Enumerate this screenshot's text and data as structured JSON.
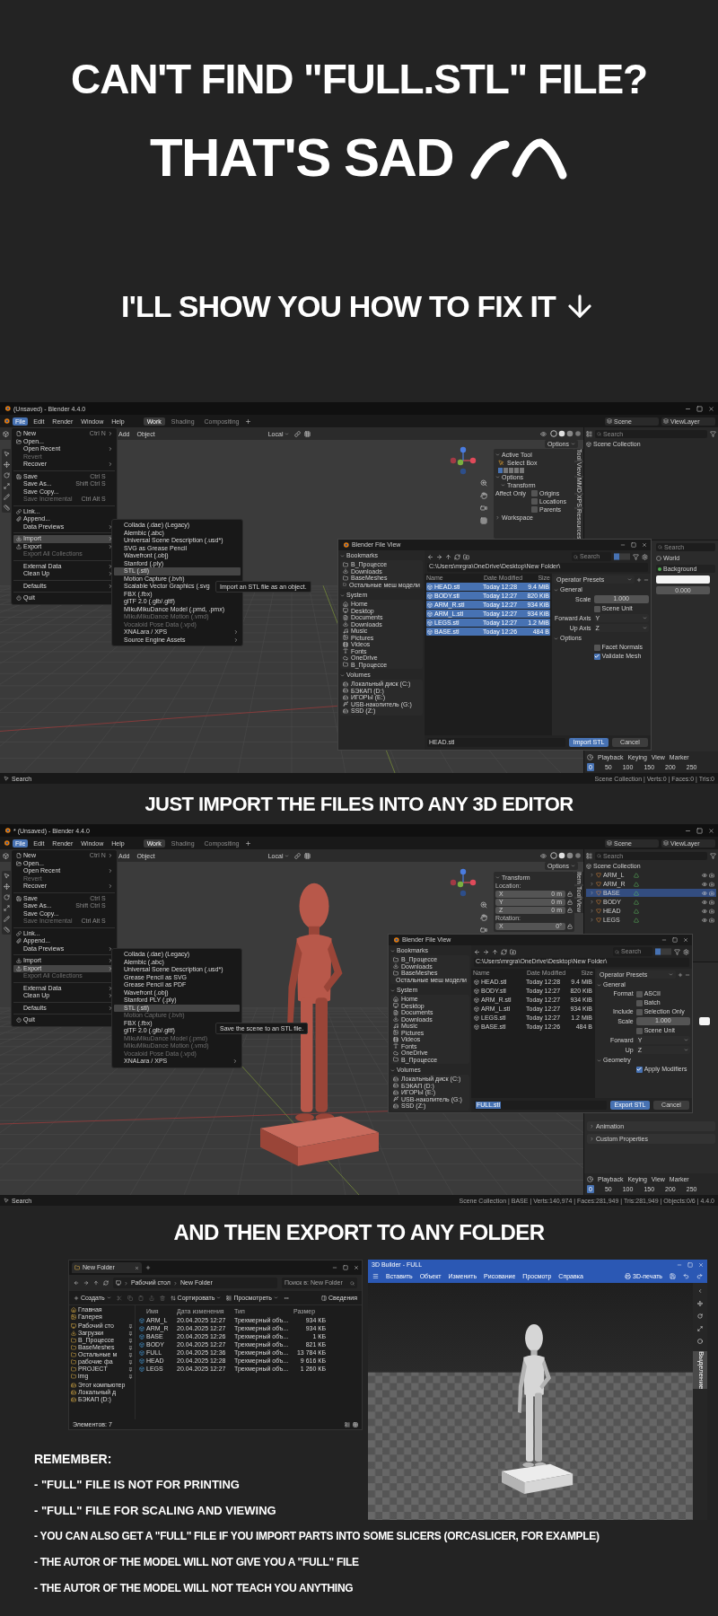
{
  "headline": {
    "line_1": "CAN'T FIND \"FULL.STL\" FILE?",
    "line_2": "THAT'S SAD",
    "line_3": "I'LL SHOW YOU HOW TO FIX IT"
  },
  "import_screenshot": {
    "title": "(Unsaved) - Blender 4.4.0",
    "menus": [
      {
        "label": "File",
        "selected": true
      },
      {
        "label": "Edit",
        "selected": false
      },
      {
        "label": "Render",
        "selected": false
      },
      {
        "label": "Window",
        "selected": false
      },
      {
        "label": "Help",
        "selected": false
      }
    ],
    "workspaces": [
      {
        "label": "Work",
        "selected": true
      },
      {
        "label": "Shading",
        "selected": false
      },
      {
        "label": "Compositing",
        "selected": false
      }
    ],
    "scene": "Scene",
    "view_layer": "ViewLayer",
    "viewport_menus": [
      "Add",
      "Object"
    ],
    "orientation": "Local",
    "options_button": "Options",
    "file_menu": [
      {
        "kind": "item",
        "label": "New",
        "shortcut": "Ctrl N",
        "submenu": true,
        "disabled": false,
        "selected": false
      },
      {
        "kind": "item",
        "label": "Open...",
        "submenu": false,
        "disabled": false,
        "selected": false
      },
      {
        "kind": "item",
        "label": "Open Recent",
        "submenu": true,
        "disabled": false,
        "selected": false
      },
      {
        "kind": "item",
        "label": "Revert",
        "submenu": false,
        "disabled": true,
        "selected": false
      },
      {
        "kind": "item",
        "label": "Recover",
        "submenu": true,
        "disabled": false,
        "selected": false
      },
      {
        "kind": "separator"
      },
      {
        "kind": "item",
        "label": "Save",
        "shortcut": "Ctrl S",
        "submenu": false,
        "disabled": false,
        "selected": false
      },
      {
        "kind": "item",
        "label": "Save As...",
        "shortcut": "Shift Ctrl S",
        "submenu": false,
        "disabled": false,
        "selected": false
      },
      {
        "kind": "item",
        "label": "Save Copy...",
        "submenu": false,
        "disabled": false,
        "selected": false
      },
      {
        "kind": "item",
        "label": "Save Incremental",
        "shortcut": "Ctrl Alt S",
        "submenu": false,
        "disabled": true,
        "selected": false
      },
      {
        "kind": "separator"
      },
      {
        "kind": "item",
        "label": "Link...",
        "submenu": false,
        "disabled": false,
        "selected": false
      },
      {
        "kind": "item",
        "label": "Append...",
        "submenu": false,
        "disabled": false,
        "selected": false
      },
      {
        "kind": "item",
        "label": "Data Previews",
        "submenu": true,
        "disabled": false,
        "selected": false
      },
      {
        "kind": "separator"
      },
      {
        "kind": "item",
        "label": "Import",
        "submenu": true,
        "disabled": false,
        "selected": true
      },
      {
        "kind": "item",
        "label": "Export",
        "submenu": true,
        "disabled": false,
        "selected": false
      },
      {
        "kind": "item",
        "label": "Export All Collections",
        "submenu": false,
        "disabled": true,
        "selected": false
      },
      {
        "kind": "separator"
      },
      {
        "kind": "item",
        "label": "External Data",
        "submenu": true,
        "disabled": false,
        "selected": false
      },
      {
        "kind": "item",
        "label": "Clean Up",
        "submenu": true,
        "disabled": false,
        "selected": false
      },
      {
        "kind": "separator"
      },
      {
        "kind": "item",
        "label": "Defaults",
        "submenu": true,
        "disabled": false,
        "selected": false
      },
      {
        "kind": "separator"
      },
      {
        "kind": "item",
        "label": "Quit",
        "submenu": false,
        "disabled": false,
        "selected": false
      }
    ],
    "submenu": [
      {
        "kind": "item",
        "label": "Collada (.dae) (Legacy)",
        "submenu": false,
        "disabled": false,
        "selected": false
      },
      {
        "kind": "item",
        "label": "Alembic (.abc)",
        "submenu": false,
        "disabled": false,
        "selected": false
      },
      {
        "kind": "item",
        "label": "Universal Scene Description (.usd*)",
        "submenu": false,
        "disabled": false,
        "selected": false
      },
      {
        "kind": "item",
        "label": "SVG as Grease Pencil",
        "submenu": false,
        "disabled": false,
        "selected": false
      },
      {
        "kind": "item",
        "label": "Wavefront (.obj)",
        "submenu": false,
        "disabled": false,
        "selected": false
      },
      {
        "kind": "item",
        "label": "Stanford (.ply)",
        "submenu": false,
        "disabled": false,
        "selected": false
      },
      {
        "kind": "item",
        "label": "STL (.stl)",
        "submenu": false,
        "disabled": false,
        "selected": true
      },
      {
        "kind": "item",
        "label": "Motion Capture (.bvh)",
        "submenu": false,
        "disabled": false,
        "selected": false
      },
      {
        "kind": "item",
        "label": "Scalable Vector Graphics (.svg",
        "disabled": false,
        "selected": false
      },
      {
        "kind": "item",
        "label": "FBX (.fbx)",
        "submenu": false,
        "disabled": false,
        "selected": false
      },
      {
        "kind": "item",
        "label": "glTF 2.0 (.glb/.gltf)",
        "submenu": false,
        "disabled": false,
        "selected": false
      },
      {
        "kind": "item",
        "label": "MikuMikuDance Model (.pmd, .pmx)",
        "submenu": false,
        "disabled": false,
        "selected": false
      },
      {
        "kind": "item",
        "label": "MikuMikuDance Motion (.vmd)",
        "submenu": false,
        "disabled": true,
        "selected": false
      },
      {
        "kind": "item",
        "label": "Vocaloid Pose Data (.vpd)",
        "submenu": false,
        "disabled": true,
        "selected": false
      },
      {
        "kind": "item",
        "label": "XNALara / XPS",
        "submenu": true,
        "disabled": false,
        "selected": false
      },
      {
        "kind": "item",
        "label": "Source Engine Assets",
        "submenu": true,
        "disabled": false,
        "selected": false
      }
    ],
    "tooltip": "Import an STL file as an object.",
    "side_panel": [
      {
        "kind": "header",
        "label": "Active Tool"
      },
      {
        "kind": "tool",
        "label": "Select Box"
      },
      {
        "kind": "header",
        "label": "Options"
      },
      {
        "kind": "subheader",
        "label": "Transform"
      },
      {
        "kind": "check",
        "prefix": "Affect Only",
        "label": "Origins",
        "checked": false
      },
      {
        "kind": "check",
        "label": "Locations",
        "checked": false
      },
      {
        "kind": "check",
        "label": "Parents",
        "checked": false
      },
      {
        "kind": "collapsed",
        "label": "Workspace"
      }
    ],
    "side_tabs": [
      "Tool",
      "View",
      "MMD",
      "XPS",
      "Resources"
    ],
    "outliner": {
      "search_placeholder": "Search",
      "collection": "Scene Collection"
    },
    "properties": {
      "search_placeholder": "Search",
      "rows": [
        {
          "kind": "title",
          "label": "World"
        },
        {
          "kind": "shader",
          "label": "Background"
        },
        {
          "kind": "color"
        },
        {
          "kind": "number",
          "value": "0.000"
        }
      ]
    },
    "file_dialog": {
      "title": "Blender File View",
      "bookmarks_label": "Bookmarks",
      "bookmarks": [
        "В_Процессе",
        "Downloads",
        "BaseMeshes",
        "Остальные меш модели"
      ],
      "system_label": "System",
      "system": [
        "Home",
        "Desktop",
        "Documents",
        "Downloads",
        "Music",
        "Pictures",
        "Videos",
        "Fonts",
        "OneDrive",
        "В_Процессе"
      ],
      "volumes_label": "Volumes",
      "volumes": [
        "Локальный диск (C:)",
        "БЭКАП (D:)",
        "ИГОРЫ (E:)",
        "USB-накопитель (G:)",
        "SSD (Z:)"
      ],
      "path": "C:\\Users\\mrgra\\OneDrive\\Desktop\\New Folder\\",
      "search_placeholder": "Search",
      "columns": [
        "Name",
        "Date Modified",
        "Size"
      ],
      "files": [
        {
          "name": "HEAD.stl",
          "date": "Today 12:28",
          "size": "9.4 MiB",
          "selected": true
        },
        {
          "name": "BODY.stl",
          "date": "Today 12:27",
          "size": "820 KiB",
          "selected": true
        },
        {
          "name": "ARM_R.stl",
          "date": "Today 12:27",
          "size": "934 KiB",
          "selected": true
        },
        {
          "name": "ARM_L.stl",
          "date": "Today 12:27",
          "size": "934 KiB",
          "selected": true
        },
        {
          "name": "LEGS.stl",
          "date": "Today 12:27",
          "size": "1.2 MiB",
          "selected": true
        },
        {
          "name": "BASE.stl",
          "date": "Today 12:26",
          "size": "484 B",
          "selected": true
        }
      ],
      "options": [
        {
          "kind": "presets",
          "label": "Operator Presets"
        },
        {
          "kind": "section",
          "label": "General"
        },
        {
          "kind": "number",
          "label": "Scale",
          "value": "1.000"
        },
        {
          "kind": "check",
          "label": "Scene Unit",
          "checked": false
        },
        {
          "kind": "select",
          "label": "Forward Axis",
          "value": "Y"
        },
        {
          "kind": "select",
          "label": "Up Axis",
          "value": "Z"
        },
        {
          "kind": "section",
          "label": "Options"
        },
        {
          "kind": "check",
          "label": "Facet Normals",
          "checked": false
        },
        {
          "kind": "check",
          "label": "Validate Mesh",
          "checked": true
        }
      ],
      "filename": "HEAD.stl",
      "filename_highlighted": false,
      "primary_button": "Import STL",
      "cancel_button": "Cancel"
    },
    "timeline": {
      "menus": [
        "Playback",
        "Keying",
        "View",
        "Marker"
      ],
      "current_frame": "0",
      "ticks": [
        "50",
        "100",
        "150",
        "200",
        "250"
      ]
    },
    "status": {
      "left": "Search",
      "right": "Scene Collection | Verts:0 | Faces:0 | Tris:0"
    }
  },
  "import_caption": "JUST IMPORT THE FILES INTO ANY 3D EDITOR",
  "export_screenshot": {
    "title": "* (Unsaved) - Blender 4.4.0",
    "menus": [
      {
        "label": "File",
        "selected": true
      },
      {
        "label": "Edit",
        "selected": false
      },
      {
        "label": "Render",
        "selected": false
      },
      {
        "label": "Window",
        "selected": false
      },
      {
        "label": "Help",
        "selected": false
      }
    ],
    "workspaces": [
      {
        "label": "Work",
        "selected": true
      },
      {
        "label": "Shading",
        "selected": false
      },
      {
        "label": "Compositing",
        "selected": false
      }
    ],
    "scene": "Scene",
    "view_layer": "ViewLayer",
    "viewport_menus": [
      "Add",
      "Object"
    ],
    "orientation": "Local",
    "options_button": "Options",
    "file_menu": [
      {
        "kind": "item",
        "label": "New",
        "shortcut": "Ctrl N",
        "submenu": true,
        "disabled": false,
        "selected": false
      },
      {
        "kind": "item",
        "label": "Open...",
        "submenu": false,
        "disabled": false,
        "selected": false
      },
      {
        "kind": "item",
        "label": "Open Recent",
        "submenu": true,
        "disabled": false,
        "selected": false
      },
      {
        "kind": "item",
        "label": "Revert",
        "submenu": false,
        "disabled": true,
        "selected": false
      },
      {
        "kind": "item",
        "label": "Recover",
        "submenu": true,
        "disabled": false,
        "selected": false
      },
      {
        "kind": "separator"
      },
      {
        "kind": "item",
        "label": "Save",
        "shortcut": "Ctrl S",
        "submenu": false,
        "disabled": false,
        "selected": false
      },
      {
        "kind": "item",
        "label": "Save As...",
        "shortcut": "Shift Ctrl S",
        "submenu": false,
        "disabled": false,
        "selected": false
      },
      {
        "kind": "item",
        "label": "Save Copy...",
        "submenu": false,
        "disabled": false,
        "selected": false
      },
      {
        "kind": "item",
        "label": "Save Incremental",
        "shortcut": "Ctrl Alt S",
        "submenu": false,
        "disabled": true,
        "selected": false
      },
      {
        "kind": "separator"
      },
      {
        "kind": "item",
        "label": "Link...",
        "submenu": false,
        "disabled": false,
        "selected": false
      },
      {
        "kind": "item",
        "label": "Append...",
        "submenu": false,
        "disabled": false,
        "selected": false
      },
      {
        "kind": "item",
        "label": "Data Previews",
        "submenu": true,
        "disabled": false,
        "selected": false
      },
      {
        "kind": "separator"
      },
      {
        "kind": "item",
        "label": "Import",
        "submenu": true,
        "disabled": false,
        "selected": false
      },
      {
        "kind": "item",
        "label": "Export",
        "submenu": true,
        "disabled": false,
        "selected": true
      },
      {
        "kind": "item",
        "label": "Export All Collections",
        "submenu": false,
        "disabled": true,
        "selected": false
      },
      {
        "kind": "separator"
      },
      {
        "kind": "item",
        "label": "External Data",
        "submenu": true,
        "disabled": false,
        "selected": false
      },
      {
        "kind": "item",
        "label": "Clean Up",
        "submenu": true,
        "disabled": false,
        "selected": false
      },
      {
        "kind": "separator"
      },
      {
        "kind": "item",
        "label": "Defaults",
        "submenu": true,
        "disabled": false,
        "selected": false
      },
      {
        "kind": "separator"
      },
      {
        "kind": "item",
        "label": "Quit",
        "submenu": false,
        "disabled": false,
        "selected": false
      }
    ],
    "submenu": [
      {
        "kind": "item",
        "label": "Collada (.dae) (Legacy)",
        "submenu": false,
        "disabled": false,
        "selected": false
      },
      {
        "kind": "item",
        "label": "Alembic (.abc)",
        "submenu": false,
        "disabled": false,
        "selected": false
      },
      {
        "kind": "item",
        "label": "Universal Scene Description (.usd*)",
        "submenu": false,
        "disabled": false,
        "selected": false
      },
      {
        "kind": "item",
        "label": "Grease Pencil as SVG",
        "submenu": false,
        "disabled": false,
        "selected": false
      },
      {
        "kind": "item",
        "label": "Grease Pencil as PDF",
        "submenu": false,
        "disabled": false,
        "selected": false
      },
      {
        "kind": "item",
        "label": "Wavefront (.obj)",
        "submenu": false,
        "disabled": false,
        "selected": false
      },
      {
        "kind": "item",
        "label": "Stanford PLY (.ply)",
        "submenu": false,
        "disabled": false,
        "selected": false
      },
      {
        "kind": "item",
        "label": "STL (.stl)",
        "submenu": false,
        "disabled": false,
        "selected": true
      },
      {
        "kind": "item",
        "label": "Motion Capture (.bvh)",
        "submenu": false,
        "disabled": true,
        "selected": false
      },
      {
        "kind": "item",
        "label": "FBX (.fbx)",
        "disabled": false,
        "selected": false
      },
      {
        "kind": "item",
        "label": "glTF 2.0 (.glb/.gltf)",
        "disabled": false,
        "selected": false
      },
      {
        "kind": "item",
        "label": "MikuMikuDance Model (.pmd)",
        "submenu": false,
        "disabled": true,
        "selected": false
      },
      {
        "kind": "item",
        "label": "MikuMikuDance Motion (.vmd)",
        "submenu": false,
        "disabled": true,
        "selected": false
      },
      {
        "kind": "item",
        "label": "Vocaloid Pose Data (.vpd)",
        "submenu": false,
        "disabled": true,
        "selected": false
      },
      {
        "kind": "item",
        "label": "XNALara / XPS",
        "submenu": true,
        "disabled": false,
        "selected": false
      }
    ],
    "tooltip": "Save the scene to an STL file.",
    "side_panel": [
      {
        "kind": "header",
        "label": "Transform"
      },
      {
        "kind": "label",
        "label": "Location:"
      },
      {
        "kind": "field",
        "axis": "X",
        "value": "0 m"
      },
      {
        "kind": "field",
        "axis": "Y",
        "value": "0 m"
      },
      {
        "kind": "field",
        "axis": "Z",
        "value": "0 m"
      },
      {
        "kind": "label",
        "label": "Rotation:"
      },
      {
        "kind": "field",
        "axis": "X",
        "value": "0°"
      }
    ],
    "side_tabs": [
      "Item",
      "Tool",
      "View"
    ],
    "outliner": {
      "search_placeholder": "Search",
      "collection": "Scene Collection",
      "objects": [
        {
          "name": "ARM_L",
          "selected": false
        },
        {
          "name": "ARM_R",
          "selected": false
        },
        {
          "name": "BASE",
          "selected": true
        },
        {
          "name": "BODY",
          "selected": false
        },
        {
          "name": "HEAD",
          "selected": false
        },
        {
          "name": "LEGS",
          "selected": false
        }
      ]
    },
    "properties": {
      "rows": [
        {
          "kind": "color"
        },
        {
          "kind": "section",
          "label": "Animation"
        },
        {
          "kind": "section",
          "label": "Custom Properties"
        }
      ]
    },
    "file_dialog": {
      "title": "Blender File View",
      "bookmarks_label": "Bookmarks",
      "bookmarks": [
        "В_Процессе",
        "Downloads",
        "BaseMeshes",
        "Остальные меш модели"
      ],
      "system_label": "System",
      "system": [
        "Home",
        "Desktop",
        "Documents",
        "Downloads",
        "Music",
        "Pictures",
        "Videos",
        "Fonts",
        "OneDrive",
        "В_Процессе"
      ],
      "volumes_label": "Volumes",
      "volumes": [
        "Локальный диск (C:)",
        "БЭКАП (D:)",
        "ИГОРЫ (E:)",
        "USB-накопитель (G:)",
        "SSD (Z:)"
      ],
      "path": "C:\\Users\\mrgra\\OneDrive\\Desktop\\New Folder\\",
      "search_placeholder": "Search",
      "columns": [
        "Name",
        "Date Modified",
        "Size"
      ],
      "files": [
        {
          "name": "HEAD.stl",
          "date": "Today 12:28",
          "size": "9.4 MiB",
          "selected": false
        },
        {
          "name": "BODY.stl",
          "date": "Today 12:27",
          "size": "820 KiB",
          "selected": false
        },
        {
          "name": "ARM_R.stl",
          "date": "Today 12:27",
          "size": "934 KiB",
          "selected": false
        },
        {
          "name": "ARM_L.stl",
          "date": "Today 12:27",
          "size": "934 KiB",
          "selected": false
        },
        {
          "name": "LEGS.stl",
          "date": "Today 12:27",
          "size": "1.2 MiB",
          "selected": false
        },
        {
          "name": "BASE.stl",
          "date": "Today 12:26",
          "size": "484 B",
          "selected": false
        }
      ],
      "options": [
        {
          "kind": "presets",
          "label": "Operator Presets"
        },
        {
          "kind": "section",
          "label": "General"
        },
        {
          "kind": "check",
          "prefix": "Format",
          "label": "ASCII",
          "checked": false
        },
        {
          "kind": "check",
          "label": "Batch",
          "checked": false
        },
        {
          "kind": "check",
          "prefix": "Include",
          "label": "Selection Only",
          "checked": false
        },
        {
          "kind": "number",
          "label": "Scale",
          "value": "1.000"
        },
        {
          "kind": "check",
          "label": "Scene Unit",
          "checked": false
        },
        {
          "kind": "select",
          "label": "Forward",
          "value": "Y"
        },
        {
          "kind": "select",
          "label": "Up",
          "value": "Z"
        },
        {
          "kind": "section",
          "label": "Geometry"
        },
        {
          "kind": "check",
          "label": "Apply Modifiers",
          "checked": true
        }
      ],
      "filename": "FULL.stl",
      "filename_highlighted": true,
      "primary_button": "Export STL",
      "cancel_button": "Cancel"
    },
    "timeline": {
      "menus": [
        "Playback",
        "Keying",
        "View",
        "Marker"
      ],
      "current_frame": "0",
      "ticks": [
        "50",
        "100",
        "150",
        "200",
        "250"
      ]
    },
    "status": {
      "left": "Search",
      "right": "Scene Collection | BASE | Verts:140,974 | Faces:281,949 | Tris:281,949 | Objects:0/6 | 4.4.0"
    }
  },
  "export_caption": "AND THEN EXPORT TO ANY FOLDER",
  "file_explorer": {
    "tab": "New Folder",
    "breadcrumbs": [
      "Рабочий стол",
      "New Folder"
    ],
    "search_placeholder": "Поиск в: New Folder",
    "commands": [
      "Создать",
      "Сортировать",
      "Просмотреть"
    ],
    "details_button": "Сведения",
    "nav": [
      {
        "label": "Главная",
        "pinned": false
      },
      {
        "label": "Галерея",
        "pinned": false
      },
      {
        "label": "Рабочий сто",
        "pinned": true
      },
      {
        "label": "Загрузки",
        "pinned": true
      },
      {
        "label": "В_Процессе",
        "pinned": true
      },
      {
        "label": "BaseMeshes",
        "pinned": true
      },
      {
        "label": "Остальные м",
        "pinned": true
      },
      {
        "label": "рабочие фа",
        "pinned": true
      },
      {
        "label": "PROJECT",
        "pinned": true
      },
      {
        "label": "img",
        "pinned": true
      },
      {
        "label": "Этот компьютер",
        "pinned": false
      },
      {
        "label": "Локальный д",
        "pinned": false
      },
      {
        "label": "БЭКАП (D:)",
        "pinned": false
      }
    ],
    "columns": [
      "Имя",
      "Дата изменения",
      "Тип",
      "Размер"
    ],
    "files": [
      {
        "name": "ARM_L",
        "date": "20.04.2025 12:27",
        "type": "Трехмерный объ...",
        "size": "934 КБ"
      },
      {
        "name": "ARM_R",
        "date": "20.04.2025 12:27",
        "type": "Трехмерный объ...",
        "size": "934 КБ"
      },
      {
        "name": "BASE",
        "date": "20.04.2025 12:26",
        "type": "Трехмерный объ...",
        "size": "1 КБ"
      },
      {
        "name": "BODY",
        "date": "20.04.2025 12:27",
        "type": "Трехмерный объ...",
        "size": "821 КБ"
      },
      {
        "name": "FULL",
        "date": "20.04.2025 12:36",
        "type": "Трехмерный объ...",
        "size": "13 784 КБ"
      },
      {
        "name": "HEAD",
        "date": "20.04.2025 12:28",
        "type": "Трехмерный объ...",
        "size": "9 616 КБ"
      },
      {
        "name": "LEGS",
        "date": "20.04.2025 12:27",
        "type": "Трехмерный объ...",
        "size": "1 260 КБ"
      }
    ],
    "status": "Элементов: 7"
  },
  "builder_3d": {
    "title": "3D Builder - FULL",
    "menus": [
      "Вставить",
      "Объект",
      "Изменить",
      "Рисование",
      "Просмотр",
      "Справка"
    ],
    "print_button": "3D-печать",
    "side_tab": "Выделение"
  },
  "notes": {
    "title": "REMEMBER:",
    "items": [
      "- \"FULL\" FILE IS NOT FOR PRINTING",
      "- \"FULL\" FILE FOR SCALING AND VIEWING",
      "- YOU CAN ALSO GET A \"FULL\" FILE IF YOU IMPORT PARTS INTO SOME SLICERS (ORCASLICER, FOR EXAMPLE)",
      "- THE AUTOR OF THE MODEL WILL NOT GIVE YOU A \"FULL\" FILE",
      "- THE AUTOR OF THE MODEL WILL NOT TEACH YOU ANYTHING"
    ]
  }
}
